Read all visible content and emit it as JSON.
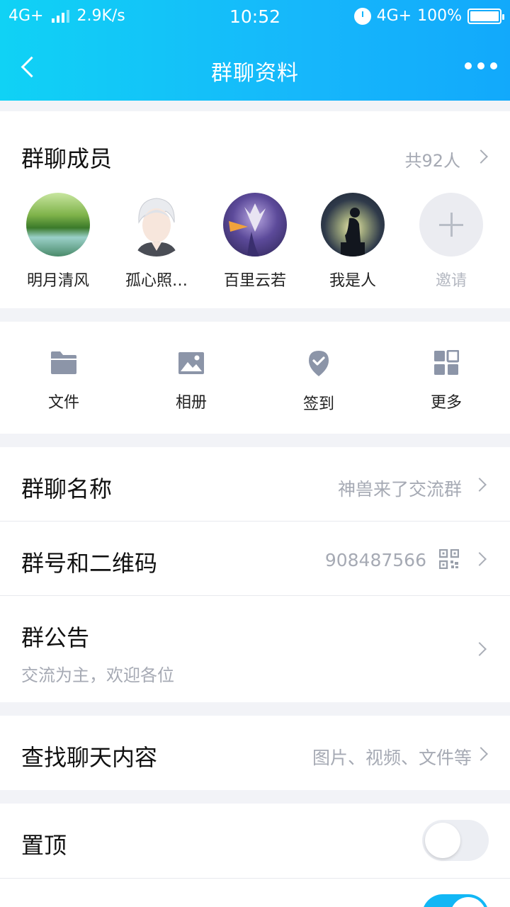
{
  "status_bar": {
    "network": "4G+",
    "speed": "2.9K/s",
    "time": "10:52",
    "network_right": "4G+",
    "battery": "100%"
  },
  "nav": {
    "title": "群聊资料",
    "back_icon": "back-chevron-icon",
    "more_icon": "more-dots-icon"
  },
  "members": {
    "heading": "群聊成员",
    "count": "共92人",
    "items": [
      {
        "name": "明月清风"
      },
      {
        "name": "孤心照…"
      },
      {
        "name": "百里云若"
      },
      {
        "name": "我是人"
      }
    ],
    "invite_label": "邀请"
  },
  "tools": [
    {
      "label": "文件",
      "icon": "folder-icon"
    },
    {
      "label": "相册",
      "icon": "photo-icon"
    },
    {
      "label": "签到",
      "icon": "checkin-icon"
    },
    {
      "label": "更多",
      "icon": "grid-icon"
    }
  ],
  "settings": {
    "group_name": {
      "label": "群聊名称",
      "value": "神兽来了交流群"
    },
    "group_id": {
      "label": "群号和二维码",
      "value": "908487566"
    },
    "announcement": {
      "label": "群公告",
      "value": "交流为主，欢迎各位"
    },
    "search": {
      "label": "查找聊天内容",
      "value": "图片、视频、文件等"
    },
    "pin": {
      "label": "置顶",
      "enabled": false
    }
  },
  "colors": {
    "accent": "#12b7f5",
    "secondary_text": "#a6aab4",
    "background": "#f2f3f7"
  }
}
